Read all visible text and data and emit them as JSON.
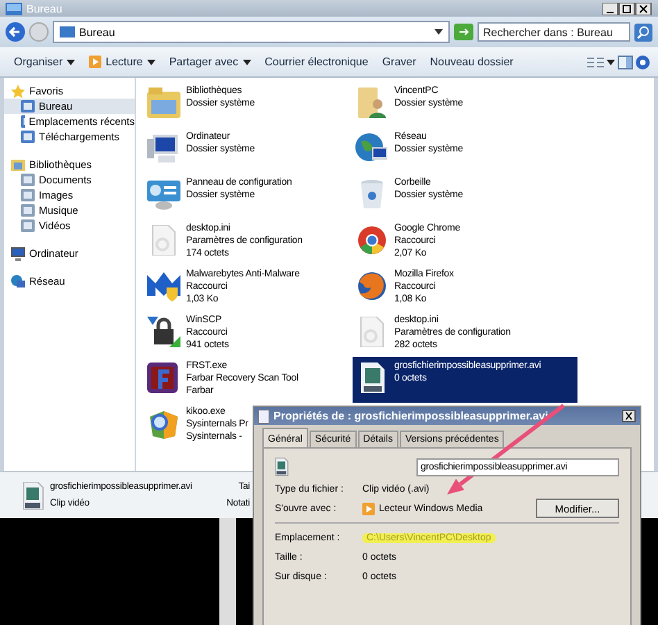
{
  "window": {
    "title": "Bureau"
  },
  "address_bar": {
    "location": "Bureau",
    "search": {
      "placeholder": "Rechercher dans : Bureau"
    }
  },
  "toolbar": [
    {
      "label": "Organiser",
      "dropdown": true
    },
    {
      "label": "Lecture",
      "dropdown": true
    },
    {
      "label": "Partager avec",
      "dropdown": true
    },
    {
      "label": "Courrier électronique",
      "dropdown": false
    },
    {
      "label": "Graver",
      "dropdown": false
    },
    {
      "label": "Nouveau dossier",
      "dropdown": false
    }
  ],
  "sidebar": {
    "groups": [
      {
        "label": "Favoris",
        "selected": false,
        "children": [
          {
            "label": "Bureau",
            "selected": true
          },
          {
            "label": "Emplacements récents",
            "selected": false
          },
          {
            "label": "Téléchargements",
            "selected": false
          }
        ]
      },
      {
        "label": "Bibliothèques",
        "selected": false,
        "children": [
          {
            "label": "Documents",
            "selected": false
          },
          {
            "label": "Images",
            "selected": false
          },
          {
            "label": "Musique",
            "selected": false
          },
          {
            "label": "Vidéos",
            "selected": false
          }
        ]
      },
      {
        "label": "Ordinateur",
        "selected": false
      },
      {
        "label": "Réseau",
        "selected": false
      }
    ]
  },
  "files": [
    {
      "name": "Bibliothèques",
      "details": [
        "Dossier système"
      ],
      "selected": false
    },
    {
      "name": "VincentPC",
      "details": [
        "Dossier système"
      ],
      "selected": false
    },
    {
      "name": "Ordinateur",
      "details": [
        "Dossier système"
      ],
      "selected": false
    },
    {
      "name": "Réseau",
      "details": [
        "Dossier système"
      ],
      "selected": false
    },
    {
      "name": "Panneau de configuration",
      "details": [
        "Dossier système"
      ],
      "selected": false
    },
    {
      "name": "Corbeille",
      "details": [
        "Dossier système"
      ],
      "selected": false
    },
    {
      "name": "desktop.ini",
      "details": [
        "Paramètres de configuration",
        "174 octets"
      ],
      "selected": false
    },
    {
      "name": "Google Chrome",
      "details": [
        "Raccourci",
        "2,07 Ko"
      ],
      "selected": false
    },
    {
      "name": "Malwarebytes Anti-Malware",
      "details": [
        "Raccourci",
        "1,03 Ko"
      ],
      "selected": false
    },
    {
      "name": "Mozilla Firefox",
      "details": [
        "Raccourci",
        "1,08 Ko"
      ],
      "selected": false
    },
    {
      "name": "WinSCP",
      "details": [
        "Raccourci",
        "941 octets"
      ],
      "selected": false
    },
    {
      "name": "desktop.ini",
      "details": [
        "Paramètres de configuration",
        "282 octets"
      ],
      "selected": false
    },
    {
      "name": "FRST.exe",
      "details": [
        "Farbar Recovery Scan Tool",
        "Farbar"
      ],
      "selected": false
    },
    {
      "name": "grosfichierimpossibleasupprimer.avi",
      "details": [
        "0 octets"
      ],
      "selected": true
    },
    {
      "name": "kikoo.exe",
      "details": [
        "Sysinternals Pr",
        "Sysinternals - "
      ],
      "selected": false
    }
  ],
  "details_pane": {
    "name": "grosfichierimpossibleasupprimer.avi",
    "type": "Clip vidéo",
    "fields": [
      "Tai",
      "Notati"
    ]
  },
  "properties_dialog": {
    "title": "Propriétés de : grosfichierimpossibleasupprimer.avi",
    "tabs": [
      {
        "label": "Général",
        "selected": true
      },
      {
        "label": "Sécurité",
        "selected": false
      },
      {
        "label": "Détails",
        "selected": false
      },
      {
        "label": "Versions précédentes",
        "selected": false
      }
    ],
    "filename": "grosfichierimpossibleasupprimer.avi",
    "type_row": {
      "label": "Type du fichier :",
      "value": "Clip vidéo (.avi)"
    },
    "opens_with": {
      "label": "S'ouvre avec :",
      "value": "Lecteur Windows Media",
      "button": "Modifier..."
    },
    "rows": [
      {
        "label": "Emplacement :",
        "value": "C:\\Users\\VincentPC\\Desktop",
        "highlighted": true
      },
      {
        "label": "Taille :",
        "value": "0 octets",
        "highlighted": false
      },
      {
        "label": "Sur disque :",
        "value": "0 octets",
        "highlighted": false
      }
    ]
  }
}
